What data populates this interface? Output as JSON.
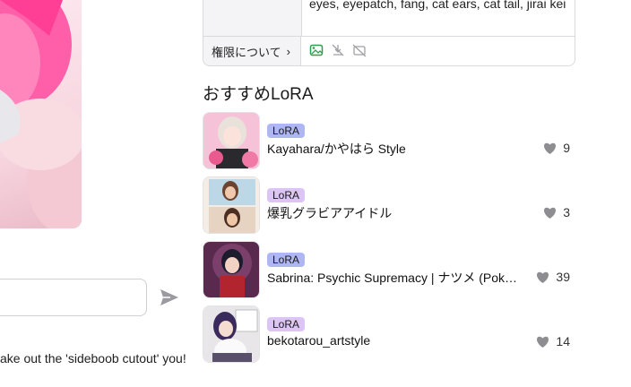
{
  "comment": {
    "placeholder": "",
    "text": "ake out the 'sideboob cutout' you!"
  },
  "meta": {
    "tags_value": "eyes, eyepatch, fang, cat ears, cat tail, jirai kei",
    "permissions_label": "権限について",
    "permission_icons": [
      "image-allowed-icon",
      "download-disabled-icon",
      "generation-disabled-icon"
    ]
  },
  "recommended": {
    "title": "おすすめLoRA",
    "items": [
      {
        "badge": "LoRA",
        "name": "Kayahara/かやはら Style",
        "likes": "9",
        "badge_color": "#aeb7f4"
      },
      {
        "badge": "LoRA",
        "name": "爆乳グラビアアイドル",
        "likes": "3",
        "badge_color": "#dcc5f4"
      },
      {
        "badge": "LoRA",
        "name": "Sabrina: Psychic Supremacy | ナツメ (Pok…",
        "likes": "39",
        "badge_color": "#aeb7f4"
      },
      {
        "badge": "LoRA",
        "name": "bekotarou_artstyle",
        "likes": "14",
        "badge_color": "#dcc5f4"
      }
    ]
  },
  "colors": {
    "accent_blue": "#aeb7f4",
    "accent_purple": "#dcc5f4",
    "heart": "#8d8d92",
    "permission_allowed": "#2e9e4f"
  }
}
